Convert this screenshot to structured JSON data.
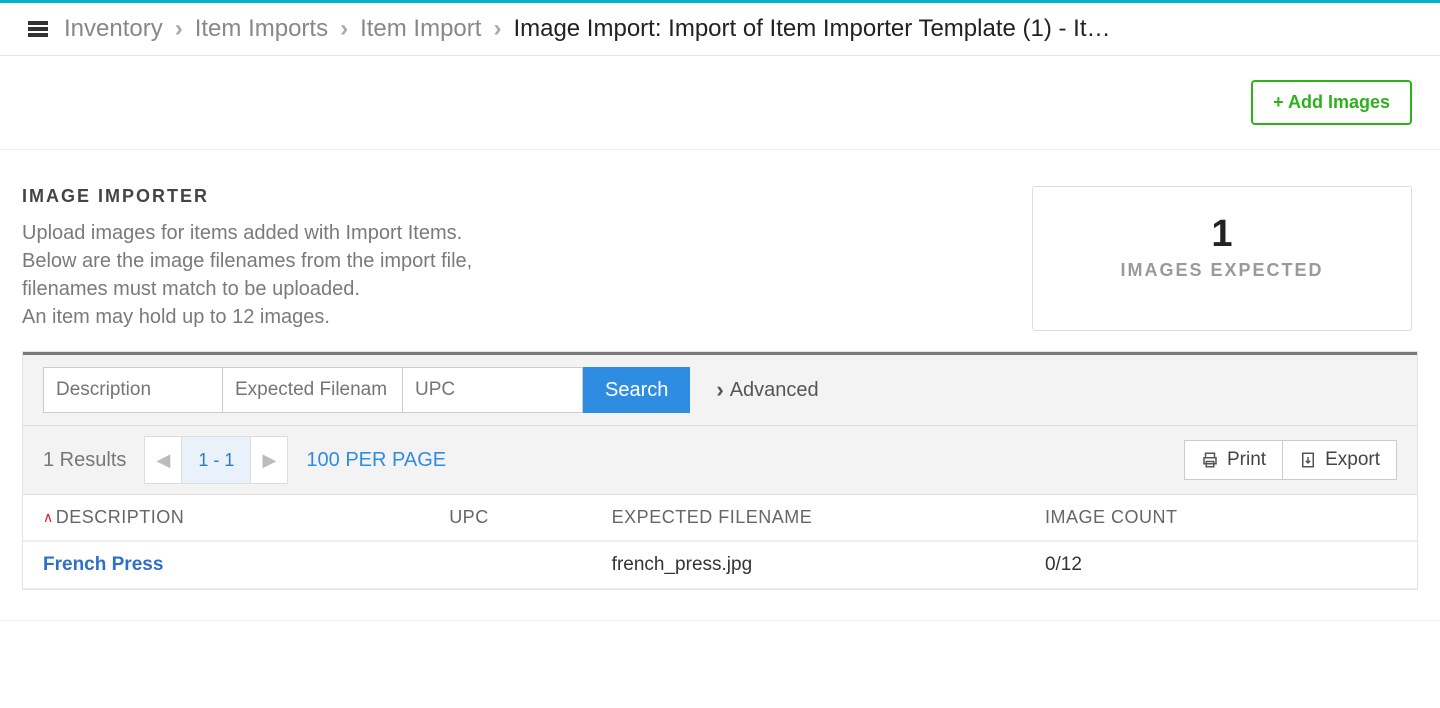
{
  "breadcrumb": {
    "items": [
      "Inventory",
      "Item Imports",
      "Item Import"
    ],
    "current": "Image Import:  Import of Item Importer Template (1) - It…"
  },
  "actions": {
    "add_images": "+ Add Images"
  },
  "importer": {
    "title": "IMAGE IMPORTER",
    "line1": "Upload images for items added with Import Items.",
    "line2": "Below are the image filenames from the import file,",
    "line3": "filenames must match to be uploaded.",
    "line4": "An item may hold up to 12 images."
  },
  "stat": {
    "value": "1",
    "label": "IMAGES EXPECTED"
  },
  "search": {
    "ph_description": "Description",
    "ph_filename": "Expected Filenam",
    "ph_upc": "UPC",
    "search_label": "Search",
    "advanced_label": "Advanced"
  },
  "results": {
    "count_text": "1 Results",
    "page_range": "1 - 1",
    "per_page": "100 PER PAGE",
    "print": "Print",
    "export": "Export"
  },
  "columns": {
    "description": "DESCRIPTION",
    "upc": "UPC",
    "expected": "EXPECTED FILENAME",
    "count": "IMAGE COUNT"
  },
  "rows": [
    {
      "description": "French Press",
      "upc": "",
      "expected": "french_press.jpg",
      "count": "0/12"
    }
  ]
}
